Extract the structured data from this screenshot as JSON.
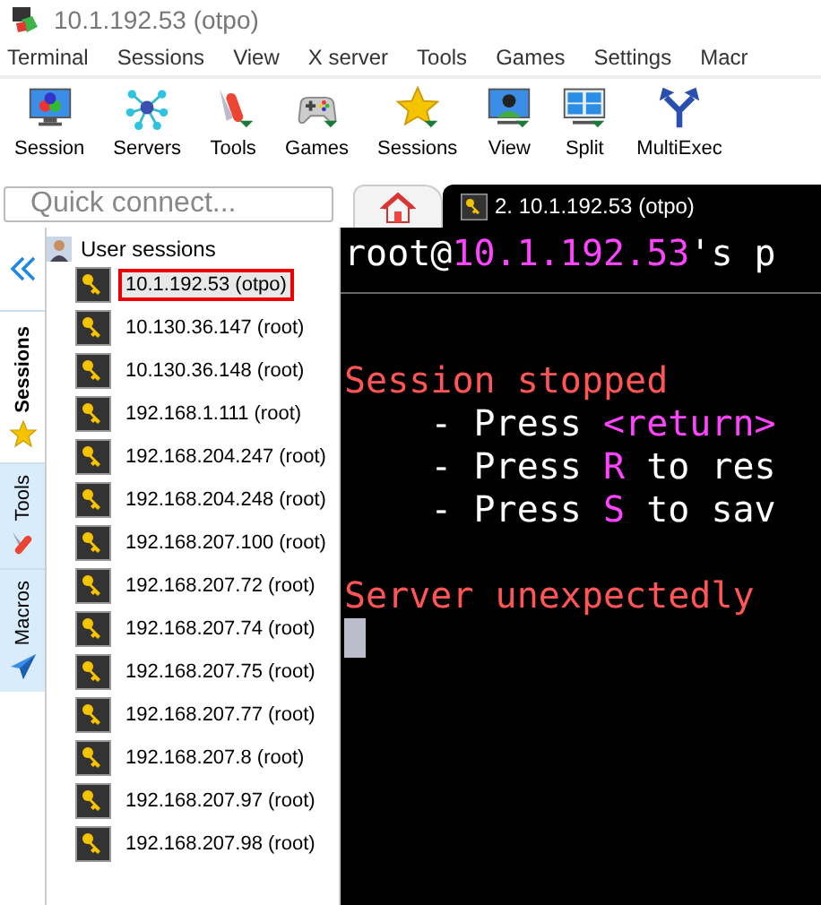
{
  "window": {
    "title": "10.1.192.53 (otpo)"
  },
  "menu": [
    "Terminal",
    "Sessions",
    "View",
    "X server",
    "Tools",
    "Games",
    "Settings",
    "Macr"
  ],
  "toolbar": [
    {
      "label": "Session",
      "kind": "session"
    },
    {
      "label": "Servers",
      "kind": "servers"
    },
    {
      "label": "Tools",
      "kind": "tools"
    },
    {
      "label": "Games",
      "kind": "games"
    },
    {
      "label": "Sessions",
      "kind": "star"
    },
    {
      "label": "View",
      "kind": "view"
    },
    {
      "label": "Split",
      "kind": "split"
    },
    {
      "label": "MultiExec",
      "kind": "multiexec"
    }
  ],
  "quick_connect": {
    "placeholder": "Quick connect..."
  },
  "side_tabs": [
    {
      "label": "Sessions",
      "kind": "star",
      "selected": true
    },
    {
      "label": "Tools",
      "kind": "tools",
      "selected": false
    },
    {
      "label": "Macros",
      "kind": "plane",
      "selected": false
    }
  ],
  "sessions": {
    "group": "User sessions",
    "items": [
      {
        "label": "10.1.192.53 (otpo)",
        "selected": true,
        "highlighted": true
      },
      {
        "label": "10.130.36.147 (root)",
        "selected": false,
        "highlighted": false
      },
      {
        "label": "10.130.36.148 (root)",
        "selected": false,
        "highlighted": false
      },
      {
        "label": "192.168.1.111 (root)",
        "selected": false,
        "highlighted": false
      },
      {
        "label": "192.168.204.247 (root)",
        "selected": false,
        "highlighted": false
      },
      {
        "label": "192.168.204.248 (root)",
        "selected": false,
        "highlighted": false
      },
      {
        "label": "192.168.207.100 (root)",
        "selected": false,
        "highlighted": false
      },
      {
        "label": "192.168.207.72 (root)",
        "selected": false,
        "highlighted": false
      },
      {
        "label": "192.168.207.74 (root)",
        "selected": false,
        "highlighted": false
      },
      {
        "label": "192.168.207.75 (root)",
        "selected": false,
        "highlighted": false
      },
      {
        "label": "192.168.207.77 (root)",
        "selected": false,
        "highlighted": false
      },
      {
        "label": "192.168.207.8 (root)",
        "selected": false,
        "highlighted": false
      },
      {
        "label": "192.168.207.97 (root)",
        "selected": false,
        "highlighted": false
      },
      {
        "label": "192.168.207.98 (root)",
        "selected": false,
        "highlighted": false
      }
    ]
  },
  "tabs": [
    {
      "kind": "home",
      "selected": false
    },
    {
      "kind": "session",
      "label": "2. 10.1.192.53 (otpo)",
      "selected": true
    }
  ],
  "terminal": {
    "lines": [
      {
        "kind": "text",
        "segments": [
          {
            "text": "root@",
            "color": "#ffffff"
          },
          {
            "text": "10.1.192.53",
            "color": "#ff44ff"
          },
          {
            "text": "'s p",
            "color": "#ffffff"
          }
        ]
      },
      {
        "kind": "rule"
      },
      {
        "kind": "blank"
      },
      {
        "kind": "text",
        "segments": [
          {
            "text": "Session stopped",
            "color": "#ff5555"
          }
        ]
      },
      {
        "kind": "text",
        "segments": [
          {
            "text": "    - Press ",
            "color": "#ffffff"
          },
          {
            "text": "<return>",
            "color": "#ff44ff"
          }
        ]
      },
      {
        "kind": "text",
        "segments": [
          {
            "text": "    - Press ",
            "color": "#ffffff"
          },
          {
            "text": "R",
            "color": "#ff44ff"
          },
          {
            "text": " to res",
            "color": "#ffffff"
          }
        ]
      },
      {
        "kind": "text",
        "segments": [
          {
            "text": "    - Press ",
            "color": "#ffffff"
          },
          {
            "text": "S",
            "color": "#ff44ff"
          },
          {
            "text": " to sav",
            "color": "#ffffff"
          }
        ]
      },
      {
        "kind": "blank"
      },
      {
        "kind": "text",
        "segments": [
          {
            "text": "Server unexpectedly",
            "color": "#ff5555"
          }
        ]
      },
      {
        "kind": "cursor"
      }
    ]
  }
}
